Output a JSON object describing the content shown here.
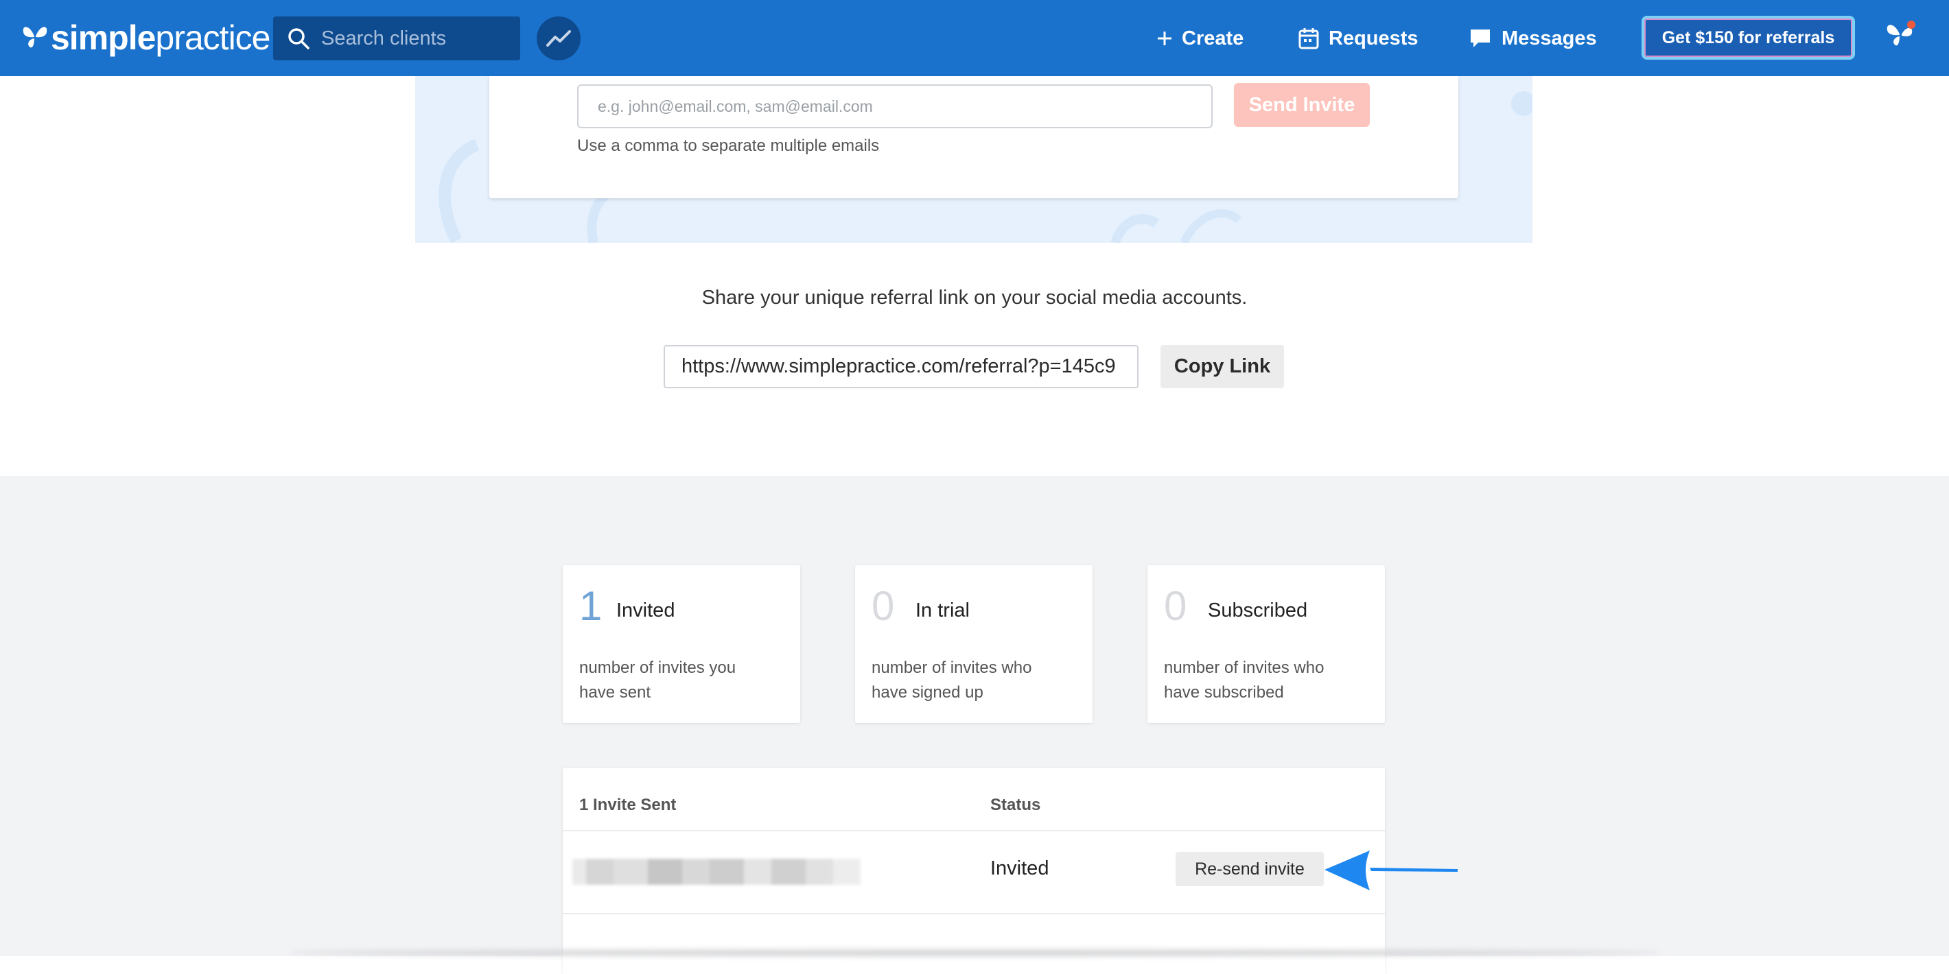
{
  "nav": {
    "logo_bold": "simple",
    "logo_light": "practice",
    "search_placeholder": "Search clients",
    "create_label": "Create",
    "requests_label": "Requests",
    "messages_label": "Messages",
    "referral_cta": "Get $150 for referrals"
  },
  "invite": {
    "email_placeholder": "e.g. john@email.com, sam@email.com",
    "send_label": "Send Invite",
    "hint": "Use a comma to separate multiple emails"
  },
  "share": {
    "text": "Share your unique referral link on your social media accounts.",
    "link_value": "https://www.simplepractice.com/referral?p=145c9",
    "copy_label": "Copy Link"
  },
  "stats": [
    {
      "count": "1",
      "label": "Invited",
      "desc": "number of invites you have sent"
    },
    {
      "count": "0",
      "label": "In trial",
      "desc": "number of invites who have signed up"
    },
    {
      "count": "0",
      "label": "Subscribed",
      "desc": "number of invites who have subscribed"
    }
  ],
  "table": {
    "header_email": "1 Invite Sent",
    "header_status": "Status",
    "rows": [
      {
        "status": "Invited",
        "action": "Re-send invite"
      }
    ]
  },
  "colors": {
    "brand_blue": "#1a72cc",
    "annotation_arrow": "#1e88f0",
    "send_disabled": "#fcc4bc"
  }
}
